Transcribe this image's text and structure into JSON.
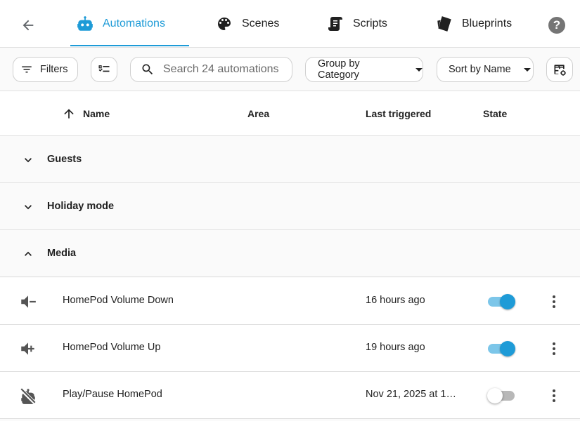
{
  "tabs": [
    {
      "label": "Automations",
      "active": true,
      "icon": "robot-icon"
    },
    {
      "label": "Scenes",
      "active": false,
      "icon": "palette-icon"
    },
    {
      "label": "Scripts",
      "active": false,
      "icon": "script-icon"
    },
    {
      "label": "Blueprints",
      "active": false,
      "icon": "blueprint-icon"
    }
  ],
  "toolbar": {
    "filters_label": "Filters",
    "search_placeholder": "Search 24 automations",
    "group_label": "Group by Category",
    "sort_label": "Sort by Name"
  },
  "table": {
    "columns": {
      "name": "Name",
      "area": "Area",
      "last_triggered": "Last triggered",
      "state": "State"
    },
    "sort_direction": "ascending"
  },
  "groups": [
    {
      "label": "Guests",
      "expanded": false
    },
    {
      "label": "Holiday mode",
      "expanded": false
    },
    {
      "label": "Media",
      "expanded": true
    }
  ],
  "rows": [
    {
      "name": "HomePod Volume Down",
      "area": "",
      "last_triggered": "16 hours ago",
      "enabled": true,
      "icon": "volume-minus-icon"
    },
    {
      "name": "HomePod Volume Up",
      "area": "",
      "last_triggered": "19 hours ago",
      "enabled": true,
      "icon": "volume-plus-icon"
    },
    {
      "name": "Play/Pause HomePod",
      "area": "",
      "last_triggered": "Nov 21, 2025 at 14:…",
      "enabled": false,
      "icon": "robot-off-icon"
    }
  ],
  "colors": {
    "accent": "#1e9bd7",
    "toggle_track_on": "#7cc6e9",
    "toggle_track_off": "#b8b8b8",
    "divider": "#e0e0e0"
  }
}
